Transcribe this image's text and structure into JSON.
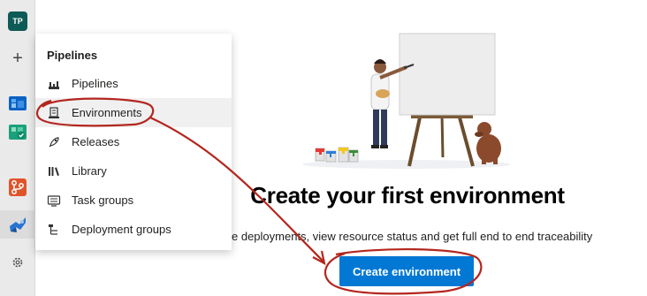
{
  "nav": {
    "avatar_initials": "TP",
    "plus_symbol": "+",
    "icons": [
      "avatar",
      "add-icon",
      "boards-icon",
      "test-plans-icon",
      "repos-icon",
      "pipelines-icon",
      "settings-icon"
    ]
  },
  "flyout": {
    "title": "Pipelines",
    "items": [
      {
        "label": "Pipelines",
        "icon": "pipelines-icon"
      },
      {
        "label": "Environments",
        "icon": "environments-icon"
      },
      {
        "label": "Releases",
        "icon": "releases-icon"
      },
      {
        "label": "Library",
        "icon": "library-icon"
      },
      {
        "label": "Task groups",
        "icon": "task-groups-icon"
      },
      {
        "label": "Deployment groups",
        "icon": "deployment-groups-icon"
      }
    ]
  },
  "main": {
    "headline": "Create your first environment",
    "subtitle": "e deployments, view resource status and get full end to end traceability",
    "button_label": "Create environment"
  },
  "colors": {
    "primary": "#0078d4",
    "annotation": "#b3261e",
    "avatar": "#0e5a57"
  }
}
